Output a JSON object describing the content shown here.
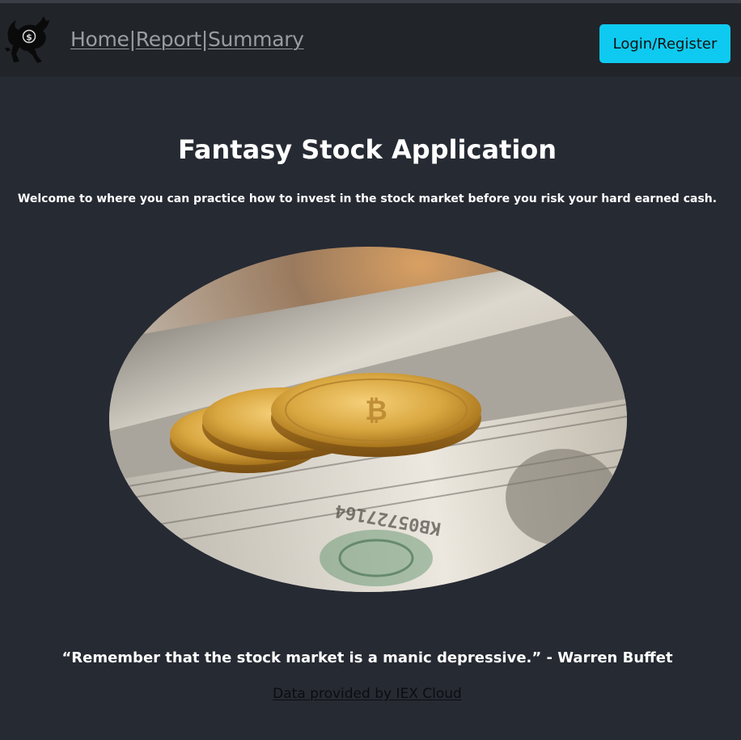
{
  "nav": {
    "links": [
      {
        "label": "Home"
      },
      {
        "label": "Report"
      },
      {
        "label": "Summary"
      }
    ],
    "separator": "|",
    "login_label": "Login/Register"
  },
  "main": {
    "title": "Fantasy Stock Application",
    "subtitle": "Welcome to where you can practice how to invest in the stock market before you risk your hard earned cash.",
    "quote": "“Remember that the stock market is a manic depressive.” - Warren Buffet",
    "credit": "Data provided by IEX Cloud"
  },
  "icons": {
    "logo": "bull-logo-icon"
  },
  "colors": {
    "background": "#262a33",
    "navbar": "#212429",
    "login_button": "#0fcaf0",
    "nav_link": "#9a9ca1"
  }
}
